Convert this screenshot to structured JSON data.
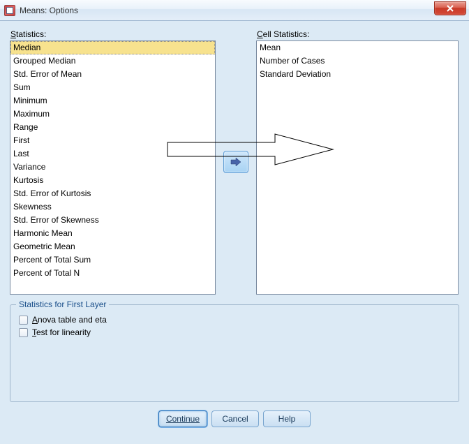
{
  "window": {
    "title": "Means: Options"
  },
  "labels": {
    "statistics_prefix": "S",
    "statistics_suffix": "tatistics:",
    "cell_prefix": "C",
    "cell_suffix": "ell Statistics:"
  },
  "statistics": {
    "items": [
      "Median",
      "Grouped Median",
      "Std. Error of Mean",
      "Sum",
      "Minimum",
      "Maximum",
      "Range",
      "First",
      "Last",
      "Variance",
      "Kurtosis",
      "Std. Error of Kurtosis",
      "Skewness",
      "Std. Error of Skewness",
      "Harmonic Mean",
      "Geometric Mean",
      "Percent of Total Sum",
      "Percent of Total N"
    ],
    "selected_index": 0
  },
  "cell_statistics": {
    "items": [
      "Mean",
      "Number of Cases",
      "Standard Deviation"
    ]
  },
  "groupbox": {
    "title": "Statistics for First Layer",
    "anova_prefix": "A",
    "anova_suffix": "nova table and eta",
    "linearity_prefix": "T",
    "linearity_suffix": "est for linearity"
  },
  "buttons": {
    "continue": "Continue",
    "cancel": "Cancel",
    "help": "Help"
  }
}
